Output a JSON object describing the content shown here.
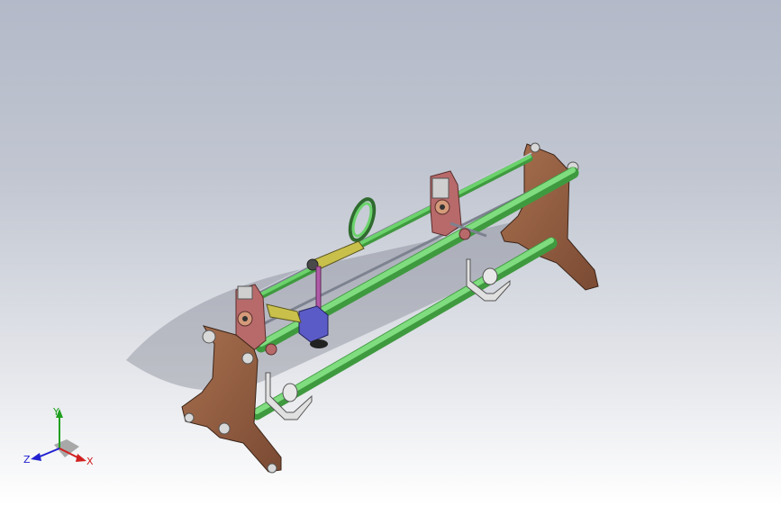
{
  "viewport": {
    "background_top": "#b3b9c8",
    "background_bottom": "#ffffff"
  },
  "model": {
    "rod_color": "#6bd36b",
    "rod_shade": "#3f9a3f",
    "frame_color": "#9a6446",
    "frame_shade": "#6b402c",
    "bracket_color": "#b86a6a",
    "guide_rod_color": "#a8adb8",
    "hook_color": "#cfcfcf",
    "wheel_color": "#5ec35e",
    "link_color": "#c8c04a",
    "pin_color": "#b05aa8",
    "block_color": "#5b5bc8"
  },
  "triad": {
    "x_label": "X",
    "y_label": "Y",
    "z_label": "Z",
    "x_color": "#d02020",
    "y_color": "#20a020",
    "z_color": "#2020d0"
  }
}
